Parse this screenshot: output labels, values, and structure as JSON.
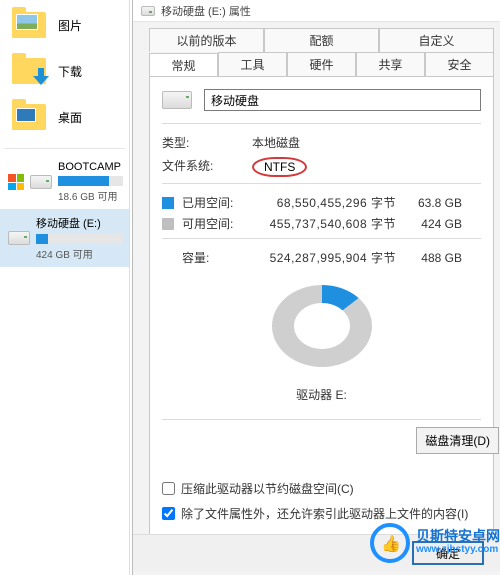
{
  "sidebar": {
    "items": [
      {
        "label": "图片"
      },
      {
        "label": "下载"
      },
      {
        "label": "桌面"
      }
    ],
    "drives": [
      {
        "name": "BOOTCAMP",
        "free_text": "18.6 GB 可用",
        "fill_pct": 78
      },
      {
        "name": "移动硬盘 (E:)",
        "free_text": "424 GB 可用",
        "fill_pct": 14
      }
    ]
  },
  "dialog": {
    "title": "移动硬盘 (E:) 属性",
    "tabs_row1": [
      "以前的版本",
      "配额",
      "自定义"
    ],
    "tabs_row2": [
      "常规",
      "工具",
      "硬件",
      "共享",
      "安全"
    ],
    "name_value": "移动硬盘",
    "type_label": "类型:",
    "type_value": "本地磁盘",
    "fs_label": "文件系统:",
    "fs_value": "NTFS",
    "used_label": "已用空间:",
    "used_bytes": "68,550,455,296 字节",
    "used_human": "63.8 GB",
    "free_label": "可用空间:",
    "free_bytes": "455,737,540,608 字节",
    "free_human": "424 GB",
    "capacity_label": "容量:",
    "capacity_bytes": "524,287,995,904 字节",
    "capacity_human": "488 GB",
    "drive_label": "驱动器 E:",
    "cleanup_label": "磁盘清理(D)",
    "compress_label": "压缩此驱动器以节约磁盘空间(C)",
    "index_label": "除了文件属性外，还允许索引此驱动器上文件的内容(I)",
    "ok_label": "确定"
  },
  "watermark": {
    "line1": "贝斯特安卓网",
    "line2": "www.zjbstyy.com"
  }
}
